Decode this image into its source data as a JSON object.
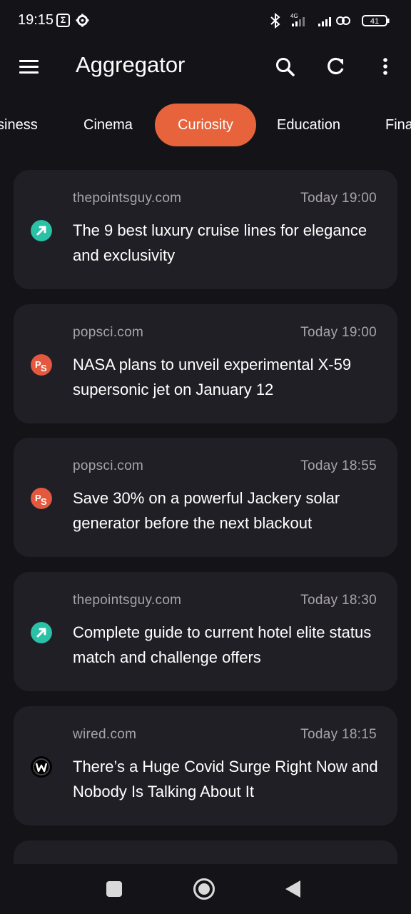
{
  "status_bar": {
    "time": "19:15",
    "notification_badge": "Σ",
    "network_label": "4G",
    "battery": "41"
  },
  "app_bar": {
    "title": "Aggregator",
    "icons": [
      "menu-icon",
      "search-icon",
      "refresh-icon",
      "more-vert-icon"
    ]
  },
  "tabs": [
    {
      "label": "Business",
      "visible_text": "siness",
      "selected": false
    },
    {
      "label": "Cinema",
      "visible_text": "Cinema",
      "selected": false
    },
    {
      "label": "Curiosity",
      "visible_text": "Curiosity",
      "selected": true
    },
    {
      "label": "Education",
      "visible_text": "Education",
      "selected": false
    },
    {
      "label": "Finance",
      "visible_text": "Fina",
      "selected": false
    }
  ],
  "articles": [
    {
      "source": "thepointsguy.com",
      "time": "Today 19:00",
      "title": "The 9 best luxury cruise lines for elegance and exclusivity",
      "icon": "thepointsguy-icon"
    },
    {
      "source": "popsci.com",
      "time": "Today 19:00",
      "title": "NASA plans to unveil experimental X-59 supersonic jet on January 12",
      "icon": "popsci-icon"
    },
    {
      "source": "popsci.com",
      "time": "Today 18:55",
      "title": "Save 30% on a powerful Jackery solar generator before the next blackout",
      "icon": "popsci-icon"
    },
    {
      "source": "thepointsguy.com",
      "time": "Today 18:30",
      "title": "Complete guide to current hotel elite status match and challenge offers",
      "icon": "thepointsguy-icon"
    },
    {
      "source": "wired.com",
      "time": "Today 18:15",
      "title": "There’s a Huge Covid Surge Right Now and Nobody Is Talking About It",
      "icon": "wired-icon"
    }
  ],
  "colors": {
    "background": "#141318",
    "card": "#211f26",
    "accent": "#e6633b",
    "secondary_text": "#a7a3ac",
    "popsci_logo": "#e4583f",
    "pointsguy_logo": "#29c2a6"
  }
}
